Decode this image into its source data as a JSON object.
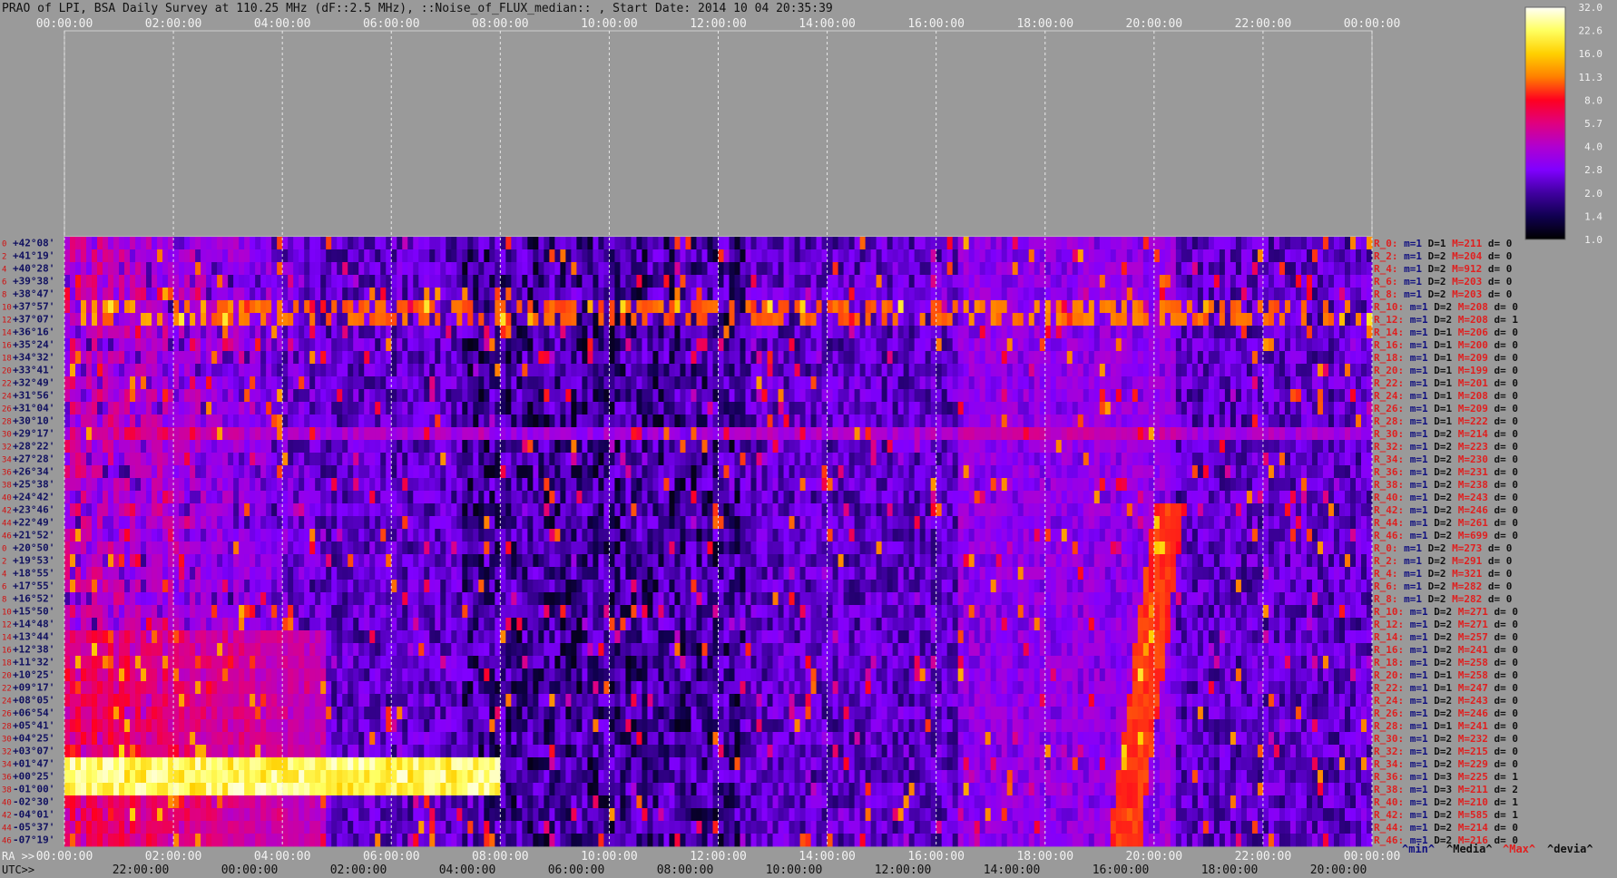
{
  "title": "PRAO of LPI, BSA Daily Survey at 110.25 MHz (dF::2.5 MHz), ::Noise_of_FLUX_median:: , Start Date: 2014 10 04 20:35:39",
  "top_time_ticks": [
    "00:00:00",
    "02:00:00",
    "04:00:00",
    "06:00:00",
    "08:00:00",
    "10:00:00",
    "12:00:00",
    "14:00:00",
    "16:00:00",
    "18:00:00",
    "20:00:00",
    "22:00:00",
    "00:00:00"
  ],
  "bottom": {
    "ra_label": "RA >>",
    "utc_label": "UTC>>",
    "ra_ticks": [
      "00:00:00",
      "02:00:00",
      "04:00:00",
      "06:00:00",
      "08:00:00",
      "10:00:00",
      "12:00:00",
      "14:00:00",
      "16:00:00",
      "18:00:00",
      "20:00:00",
      "22:00:00",
      "00:00:00"
    ],
    "utc_ticks": [
      "22:00:00",
      "00:00:00",
      "02:00:00",
      "04:00:00",
      "06:00:00",
      "08:00:00",
      "10:00:00",
      "12:00:00",
      "14:00:00",
      "16:00:00",
      "18:00:00",
      "20:00:00"
    ]
  },
  "colorbar": {
    "ticks": [
      "32.0",
      "22.6",
      "16.0",
      "11.3",
      "8.0",
      "5.7",
      "4.0",
      "2.8",
      "2.0",
      "1.4",
      "1.0"
    ],
    "colors": [
      "#fffff8",
      "#ffff60",
      "#ffd000",
      "#ff8000",
      "#ff0020",
      "#e00080",
      "#b000d0",
      "#8000ff",
      "#4000a0",
      "#100050",
      "#000000"
    ]
  },
  "chart_data": {
    "type": "heatmap",
    "title": "PRAO of LPI, BSA Daily Survey at 110.25 MHz (dF::2.5 MHz), ::Noise_of_FLUX_median:: , Start Date: 2014 10 04 20:35:39",
    "xlabel": "RA >>",
    "x_range": [
      "00:00:00",
      "00:00:00"
    ],
    "y_rows": {
      "index_labels": [
        "0",
        "2",
        "4",
        "6",
        "8",
        "10",
        "12",
        "14",
        "16",
        "18",
        "20",
        "22",
        "24",
        "26",
        "28",
        "30",
        "32",
        "34",
        "36",
        "38",
        "40",
        "42",
        "44",
        "46",
        "0",
        "2",
        "4",
        "6",
        "8",
        "10",
        "12",
        "14",
        "16",
        "18",
        "20",
        "22",
        "24",
        "26",
        "28",
        "30",
        "32",
        "34",
        "36",
        "38",
        "40",
        "42",
        "44",
        "46"
      ],
      "declinations": [
        "+42°08'",
        "+41°19'",
        "+40°28'",
        "+39°38'",
        "+38°47'",
        "+37°57'",
        "+37°07'",
        "+36°16'",
        "+35°24'",
        "+34°32'",
        "+33°41'",
        "+32°49'",
        "+31°56'",
        "+31°04'",
        "+30°10'",
        "+29°17'",
        "+28°22'",
        "+27°28'",
        "+26°34'",
        "+25°38'",
        "+24°42'",
        "+23°46'",
        "+22°49'",
        "+21°52'",
        "+20°50'",
        "+19°53'",
        "+18°55'",
        "+17°55'",
        "+16°52'",
        "+15°50'",
        "+14°48'",
        "+13°44'",
        "+12°38'",
        "+11°32'",
        "+10°25'",
        "+09°17'",
        "+08°05'",
        "+06°54'",
        "+05°41'",
        "+04°25'",
        "+03°07'",
        "+01°47'",
        "+00°25'",
        "-01°00'",
        "-02°30'",
        "-04°01'",
        "-05°37'",
        "-07°19'"
      ]
    },
    "color_scale_ticks": [
      32.0,
      22.6,
      16.0,
      11.3,
      8.0,
      5.7,
      4.0,
      2.8,
      2.0,
      1.4,
      1.0
    ],
    "legend_header": [
      "^min^",
      "^Media^",
      "^Max^",
      "^devia^"
    ],
    "row_stats": [
      {
        "r": "R_0:",
        "m": "m=1",
        "D": "D=1",
        "M": "M=211",
        "d": "d= 0"
      },
      {
        "r": "R_2:",
        "m": "m=1",
        "D": "D=2",
        "M": "M=204",
        "d": "d= 0"
      },
      {
        "r": "R_4:",
        "m": "m=1",
        "D": "D=2",
        "M": "M=912",
        "d": "d= 0"
      },
      {
        "r": "R_6:",
        "m": "m=1",
        "D": "D=2",
        "M": "M=203",
        "d": "d= 0"
      },
      {
        "r": "R_8:",
        "m": "m=1",
        "D": "D=2",
        "M": "M=203",
        "d": "d= 0"
      },
      {
        "r": "R_10:",
        "m": "m=1",
        "D": "D=2",
        "M": "M=208",
        "d": "d= 0"
      },
      {
        "r": "R_12:",
        "m": "m=1",
        "D": "D=2",
        "M": "M=208",
        "d": "d= 1"
      },
      {
        "r": "R_14:",
        "m": "m=1",
        "D": "D=1",
        "M": "M=206",
        "d": "d= 0"
      },
      {
        "r": "R_16:",
        "m": "m=1",
        "D": "D=1",
        "M": "M=200",
        "d": "d= 0"
      },
      {
        "r": "R_18:",
        "m": "m=1",
        "D": "D=1",
        "M": "M=209",
        "d": "d= 0"
      },
      {
        "r": "R_20:",
        "m": "m=1",
        "D": "D=1",
        "M": "M=199",
        "d": "d= 0"
      },
      {
        "r": "R_22:",
        "m": "m=1",
        "D": "D=1",
        "M": "M=201",
        "d": "d= 0"
      },
      {
        "r": "R_24:",
        "m": "m=1",
        "D": "D=1",
        "M": "M=208",
        "d": "d= 0"
      },
      {
        "r": "R_26:",
        "m": "m=1",
        "D": "D=1",
        "M": "M=209",
        "d": "d= 0"
      },
      {
        "r": "R_28:",
        "m": "m=1",
        "D": "D=1",
        "M": "M=222",
        "d": "d= 0"
      },
      {
        "r": "R_30:",
        "m": "m=1",
        "D": "D=2",
        "M": "M=214",
        "d": "d= 0"
      },
      {
        "r": "R_32:",
        "m": "m=1",
        "D": "D=2",
        "M": "M=223",
        "d": "d= 0"
      },
      {
        "r": "R_34:",
        "m": "m=1",
        "D": "D=2",
        "M": "M=230",
        "d": "d= 0"
      },
      {
        "r": "R_36:",
        "m": "m=1",
        "D": "D=2",
        "M": "M=231",
        "d": "d= 0"
      },
      {
        "r": "R_38:",
        "m": "m=1",
        "D": "D=2",
        "M": "M=238",
        "d": "d= 0"
      },
      {
        "r": "R_40:",
        "m": "m=1",
        "D": "D=2",
        "M": "M=243",
        "d": "d= 0"
      },
      {
        "r": "R_42:",
        "m": "m=1",
        "D": "D=2",
        "M": "M=246",
        "d": "d= 0"
      },
      {
        "r": "R_44:",
        "m": "m=1",
        "D": "D=2",
        "M": "M=261",
        "d": "d= 0"
      },
      {
        "r": "R_46:",
        "m": "m=1",
        "D": "D=2",
        "M": "M=699",
        "d": "d= 0"
      },
      {
        "r": "R_0:",
        "m": "m=1",
        "D": "D=2",
        "M": "M=273",
        "d": "d= 0"
      },
      {
        "r": "R_2:",
        "m": "m=1",
        "D": "D=2",
        "M": "M=291",
        "d": "d= 0"
      },
      {
        "r": "R_4:",
        "m": "m=1",
        "D": "D=2",
        "M": "M=321",
        "d": "d= 0"
      },
      {
        "r": "R_6:",
        "m": "m=1",
        "D": "D=2",
        "M": "M=282",
        "d": "d= 0"
      },
      {
        "r": "R_8:",
        "m": "m=1",
        "D": "D=2",
        "M": "M=282",
        "d": "d= 0"
      },
      {
        "r": "R_10:",
        "m": "m=1",
        "D": "D=2",
        "M": "M=271",
        "d": "d= 0"
      },
      {
        "r": "R_12:",
        "m": "m=1",
        "D": "D=2",
        "M": "M=271",
        "d": "d= 0"
      },
      {
        "r": "R_14:",
        "m": "m=1",
        "D": "D=2",
        "M": "M=257",
        "d": "d= 0"
      },
      {
        "r": "R_16:",
        "m": "m=1",
        "D": "D=2",
        "M": "M=241",
        "d": "d= 0"
      },
      {
        "r": "R_18:",
        "m": "m=1",
        "D": "D=2",
        "M": "M=258",
        "d": "d= 0"
      },
      {
        "r": "R_20:",
        "m": "m=1",
        "D": "D=1",
        "M": "M=258",
        "d": "d= 0"
      },
      {
        "r": "R_22:",
        "m": "m=1",
        "D": "D=1",
        "M": "M=247",
        "d": "d= 0"
      },
      {
        "r": "R_24:",
        "m": "m=1",
        "D": "D=2",
        "M": "M=243",
        "d": "d= 0"
      },
      {
        "r": "R_26:",
        "m": "m=1",
        "D": "D=2",
        "M": "M=246",
        "d": "d= 0"
      },
      {
        "r": "R_28:",
        "m": "m=1",
        "D": "D=1",
        "M": "M=241",
        "d": "d= 0"
      },
      {
        "r": "R_30:",
        "m": "m=1",
        "D": "D=2",
        "M": "M=232",
        "d": "d= 0"
      },
      {
        "r": "R_32:",
        "m": "m=1",
        "D": "D=2",
        "M": "M=215",
        "d": "d= 0"
      },
      {
        "r": "R_34:",
        "m": "m=1",
        "D": "D=2",
        "M": "M=229",
        "d": "d= 0"
      },
      {
        "r": "R_36:",
        "m": "m=1",
        "D": "D=3",
        "M": "M=225",
        "d": "d= 1"
      },
      {
        "r": "R_38:",
        "m": "m=1",
        "D": "D=3",
        "M": "M=211",
        "d": "d= 2"
      },
      {
        "r": "R_40:",
        "m": "m=1",
        "D": "D=2",
        "M": "M=210",
        "d": "d= 1"
      },
      {
        "r": "R_42:",
        "m": "m=1",
        "D": "D=2",
        "M": "M=585",
        "d": "d= 1"
      },
      {
        "r": "R_44:",
        "m": "m=1",
        "D": "D=2",
        "M": "M=214",
        "d": "d= 0"
      },
      {
        "r": "R_46:",
        "m": "m=1",
        "D": "D=2",
        "M": "M=216",
        "d": "d= 0"
      }
    ]
  }
}
